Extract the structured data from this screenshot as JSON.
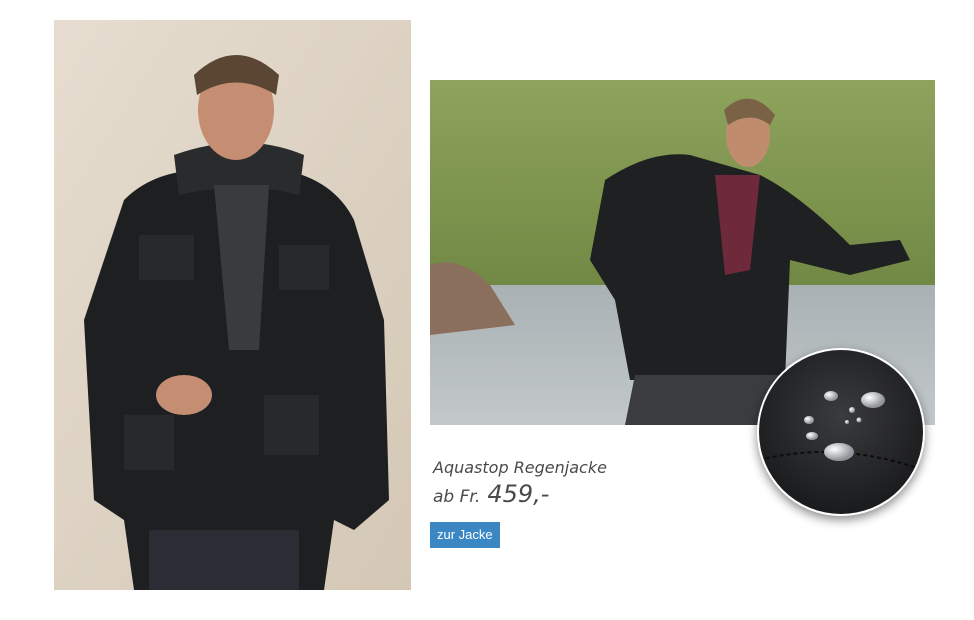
{
  "product": {
    "name": "Aquastop Regenjacke",
    "price_prefix": "ab Fr.",
    "price": "459,-"
  },
  "cta": {
    "label": "zur Jacke"
  },
  "images": {
    "model_studio": "man-in-black-parka-photo",
    "model_outdoor": "man-in-black-parka-outdoor-photo",
    "fabric_detail": "water-droplets-on-fabric-detail"
  },
  "colors": {
    "button": "#3a87c4",
    "text": "#4a4a4a",
    "background": "#ffffff"
  }
}
